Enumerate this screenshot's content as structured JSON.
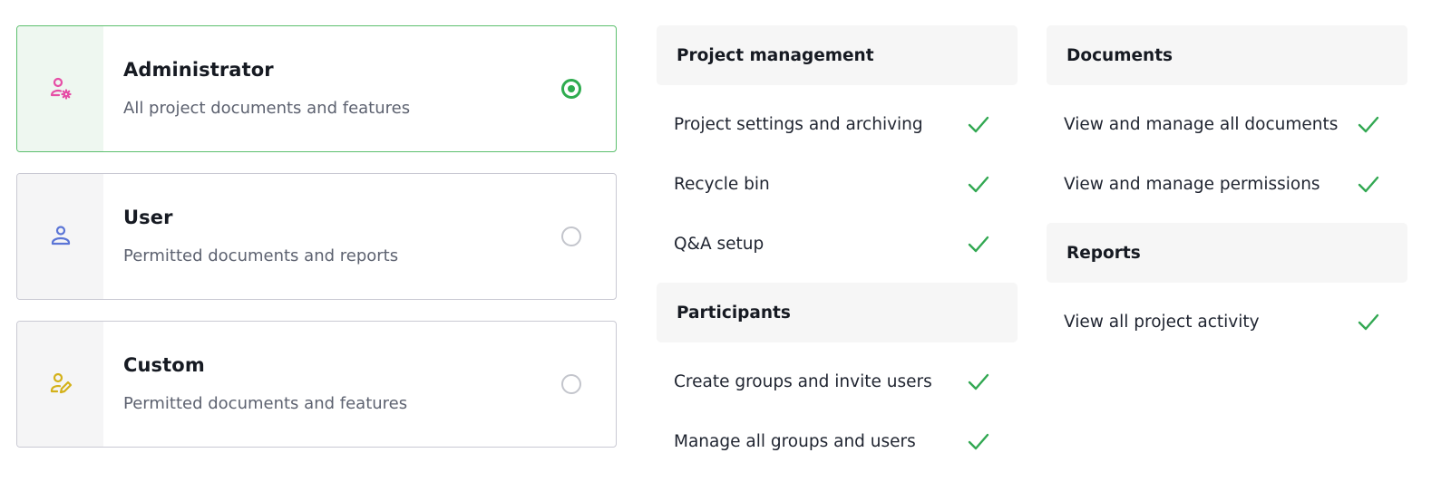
{
  "roles": [
    {
      "title": "Administrator",
      "description": "All project documents and features",
      "icon": "user-gear-icon",
      "icon_color": "#e64ea6",
      "selected": true
    },
    {
      "title": "User",
      "description": "Permitted documents and reports",
      "icon": "user-icon",
      "icon_color": "#5b75d6",
      "selected": false
    },
    {
      "title": "Custom",
      "description": "Permitted documents and features",
      "icon": "user-edit-icon",
      "icon_color": "#d4b11a",
      "selected": false
    }
  ],
  "permissions": {
    "columns": [
      [
        {
          "title": "Project management",
          "items": [
            "Project settings and archiving",
            "Recycle bin",
            "Q&A setup"
          ]
        },
        {
          "title": "Participants",
          "items": [
            "Create groups and invite users",
            "Manage all groups and users"
          ]
        }
      ],
      [
        {
          "title": "Documents",
          "items": [
            "View and manage all documents",
            "View and manage permissions"
          ]
        },
        {
          "title": "Reports",
          "items": [
            "View all project activity"
          ]
        }
      ]
    ],
    "check_icon": "checkmark-icon"
  },
  "colors": {
    "accent_green": "#2fac4f",
    "selected_border": "#5cbf6e",
    "check_green": "#32a852"
  }
}
